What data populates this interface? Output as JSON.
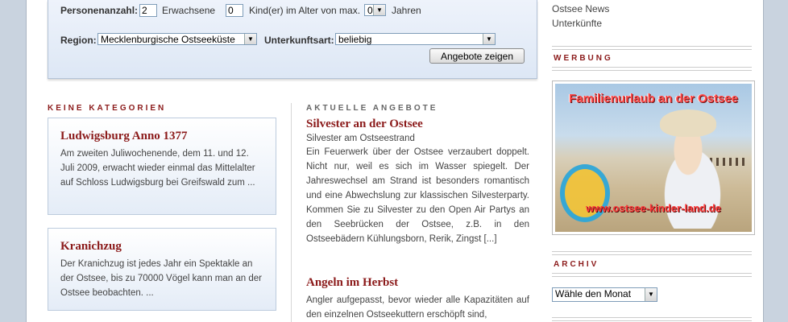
{
  "search": {
    "persons_label": "Personenanzahl:",
    "adults_value": "2",
    "adults_label": "Erwachsene",
    "children_value": "0",
    "children_label": "Kind(er) im Alter von max.",
    "age_value": "0",
    "years_label": "Jahren",
    "region_label": "Region:",
    "region_value": "Mecklenburgische Ostseeküste",
    "type_label": "Unterkunftsart:",
    "type_value": "beliebig",
    "submit_label": "Angebote zeigen"
  },
  "left": {
    "heading": "KEINE KATEGORIEN",
    "cards": [
      {
        "title": "Ludwigsburg Anno 1377",
        "text": "Am zweiten Juliwochenende, dem 11. und 12. Juli 2009, erwacht wieder einmal das Mittelalter auf Schloss Ludwigsburg bei Greifswald zum ..."
      },
      {
        "title": "Kranichzug",
        "text": "Der Kranichzug ist jedes Jahr ein Spektakle an der Ostsee, bis zu 70000 Vögel kann man an der Ostsee beobachten. ..."
      }
    ]
  },
  "middle": {
    "heading": "AKTUELLE ANGEBOTE",
    "offers": [
      {
        "title": "Silvester an der Ostsee",
        "subtitle": "Silvester am Ostseestrand",
        "text": "Ein Feuerwerk über der Ostsee verzaubert doppelt. Nicht nur, weil es sich im Wasser spiegelt. Der Jahreswechsel am Strand ist besonders romantisch und eine Abwechslung zur klassischen Silvesterparty. Kommen Sie zu Silvester zu den Open Air Partys an den Seebrücken der Ostsee, z.B. in den Ostseebädern Kühlungsborn, Rerik, Zingst [...]"
      },
      {
        "title": "Angeln im Herbst",
        "subtitle": "",
        "text": "Angler aufgepasst, bevor wieder alle Kapazitäten auf den einzelnen Ostseekuttern erschöpft sind,"
      }
    ]
  },
  "sidebar": {
    "links": [
      "Ostsee News",
      "Unterkünfte"
    ],
    "ad_heading": "WERBUNG",
    "ad_title": "Familienurlaub an der Ostsee",
    "ad_url": "www.ostsee-kinder-land.de",
    "archive_heading": "ARCHIV",
    "archive_select": "Wähle den Monat"
  },
  "colors": {
    "accent": "#8b1a1a",
    "background": "#c9d3df"
  }
}
